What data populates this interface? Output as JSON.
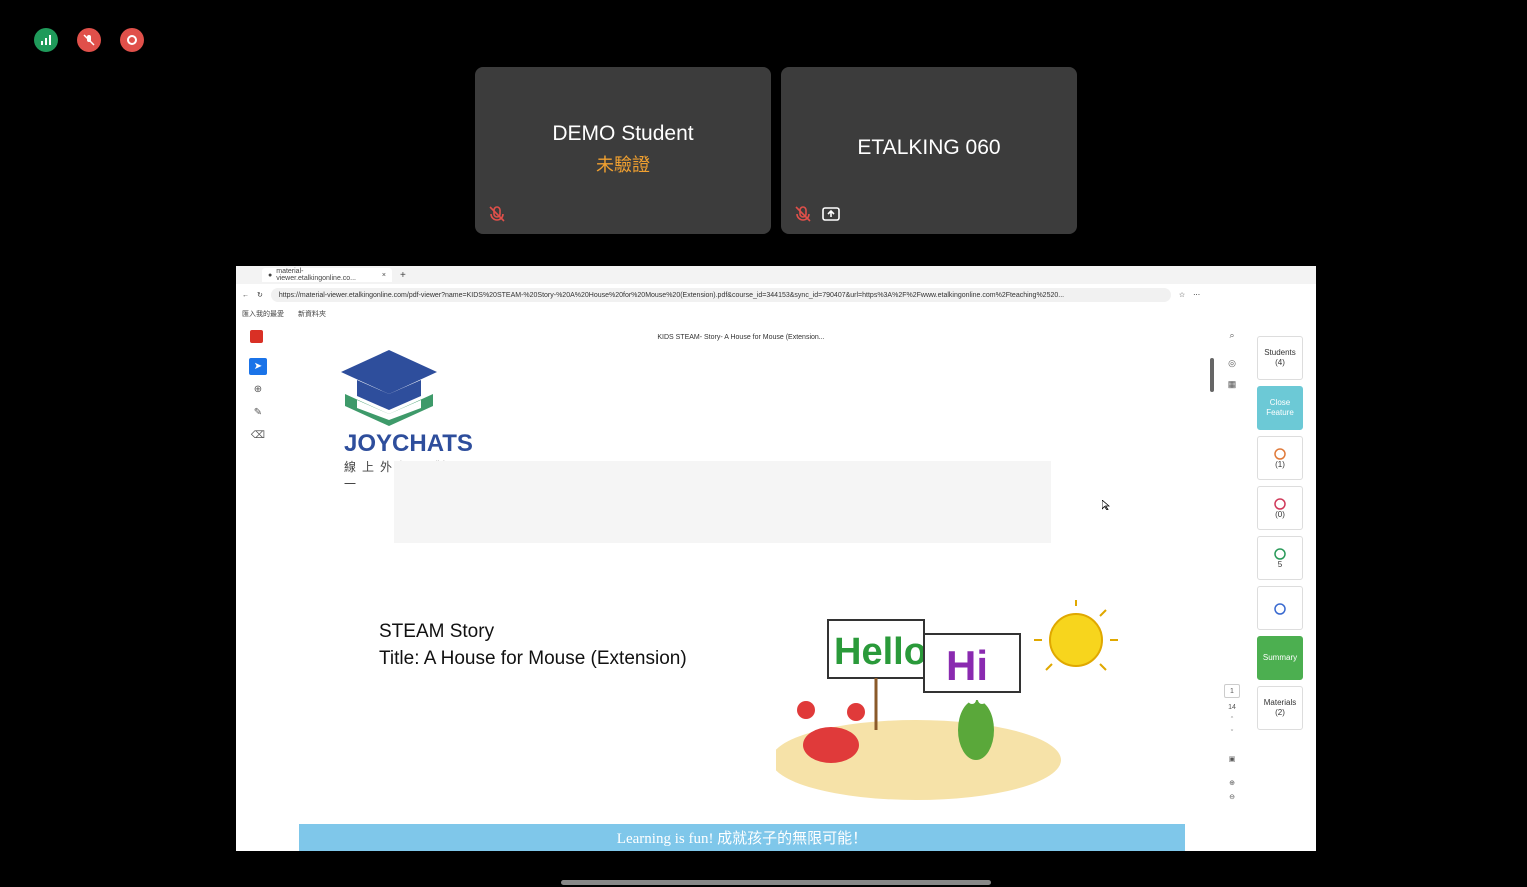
{
  "status_icons": [
    {
      "name": "signal-icon",
      "color": "#1f9a5a"
    },
    {
      "name": "mic-off-icon",
      "color": "#e0504a"
    },
    {
      "name": "record-icon",
      "color": "#e0504a"
    }
  ],
  "participants": [
    {
      "name": "DEMO Student",
      "status": "未驗證",
      "icons": [
        "mic-off-icon"
      ]
    },
    {
      "name": "ETALKING 060",
      "status": "",
      "icons": [
        "mic-off-icon",
        "screen-share-icon"
      ]
    }
  ],
  "browser": {
    "tab_title": "material-viewer.etalkingonline.co...",
    "tab_close": "×",
    "new_tab": "+",
    "url": "https://material-viewer.etalkingonline.com/pdf-viewer?name=KIDS%20STEAM-%20Story-%20A%20House%20for%20Mouse%20(Extension).pdf&course_id=344153&sync_id=790407&url=https%3A%2F%2Fwww.etalkingonline.com%2Fteaching%2520...",
    "favorites": [
      "匯入我的最愛",
      "新資料夾"
    ]
  },
  "pdf": {
    "doc_title": "KIDS STEAM- Story- A House for Mouse (Extension...",
    "logo_text": "JOYCHATS",
    "logo_sub": "線上外師一對一",
    "story_line1": "STEAM Story",
    "story_line2": "Title: A House for Mouse (Extension)",
    "scene_sign1": "Hello",
    "scene_sign2": "Hi",
    "footer": "Learning is fun! 成就孩子的無限可能！",
    "page_current": "1",
    "page_total": "14"
  },
  "sidebar": {
    "students_label": "Students",
    "students_count": "(4)",
    "close_feature": "Close Feature",
    "reward1_count": "(1)",
    "reward2_count": "(0)",
    "reward3_count": "5",
    "summary": "Summary",
    "materials_label": "Materials",
    "materials_count": "(2)"
  },
  "colors": {
    "tile_bg": "#3c3c3c",
    "unverified": "#f0a030",
    "teal": "#6cc9d6",
    "green": "#4caf50",
    "footer_band": "#7fc7ea",
    "logo_blue": "#2e4e9c"
  }
}
